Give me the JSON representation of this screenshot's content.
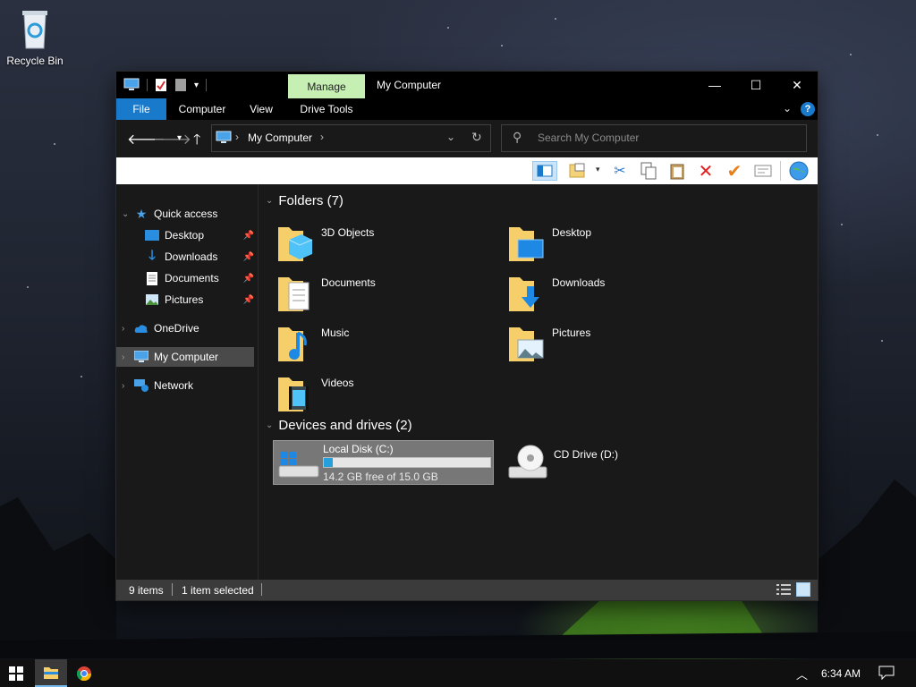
{
  "desktop": {
    "recycle_bin_label": "Recycle Bin"
  },
  "window": {
    "title": "My Computer",
    "contextual_tab": "Manage",
    "ribbon_tabs": [
      "File",
      "Computer",
      "View",
      "Drive Tools"
    ],
    "caption": {
      "minimize": "—",
      "maximize": "☐",
      "close": "✕"
    },
    "help_icon": "?"
  },
  "address_bar": {
    "location": "My Computer",
    "separator": "›"
  },
  "search": {
    "placeholder": "Search My Computer"
  },
  "nav_pane": {
    "quick_access": "Quick access",
    "pinned": [
      "Desktop",
      "Downloads",
      "Documents",
      "Pictures"
    ],
    "onedrive": "OneDrive",
    "my_computer": "My Computer",
    "network": "Network"
  },
  "content": {
    "folders_header": "Folders (7)",
    "folders": [
      "3D Objects",
      "Desktop",
      "Documents",
      "Downloads",
      "Music",
      "Pictures",
      "Videos"
    ],
    "devices_header": "Devices and drives (2)",
    "local_disk": {
      "name": "Local Disk (C:)",
      "free_text": "14.2 GB free of 15.0 GB",
      "used_fraction": 0.053
    },
    "cd_drive": {
      "name": "CD Drive (D:)"
    }
  },
  "status": {
    "items": "9 items",
    "selected": "1 item selected"
  },
  "taskbar": {
    "time": "6:34 AM"
  },
  "colors": {
    "accent": "#1979ca",
    "manage_tab": "#c6efb4",
    "window_bg": "#191919",
    "selection": "#777777"
  }
}
